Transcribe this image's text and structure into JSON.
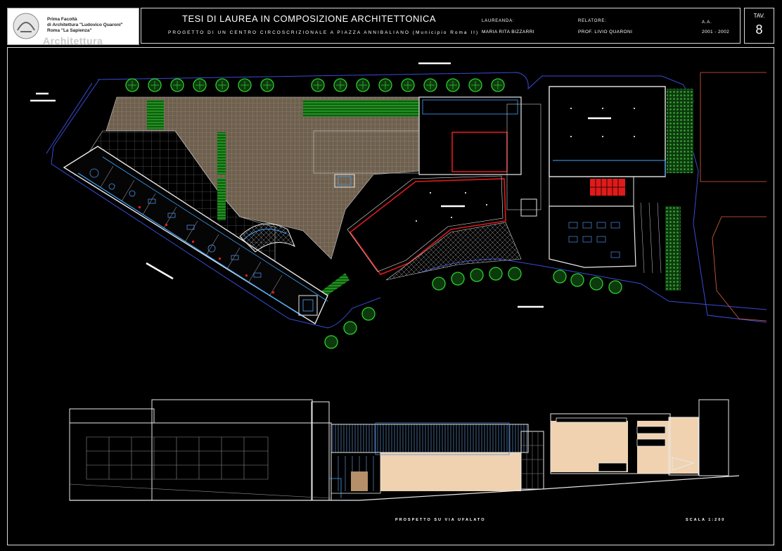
{
  "logo": {
    "lines": [
      "Prima Facoltà",
      "di Architettura \"Ludovico Quaroni\"",
      "Roma \"La Sapienza\""
    ],
    "wordmark": "Architettura"
  },
  "title_block": {
    "title": "TESI DI LAUREA IN COMPOSIZIONE ARCHITETTONICA",
    "subtitle": "PROGETTO DI UN CENTRO CIRCOSCRIZIONALE A PIAZZA ANNIBALIANO (Municipio Roma II)",
    "laureanda_label": "LAUREANDA:",
    "laureanda": "MARIA RITA BIZZARRI",
    "relatore_label": "RELATORE:",
    "relatore": "PROF. LIVIO QUARONI",
    "aa_label": "A.A.",
    "aa": "2001 - 2002"
  },
  "sheet": {
    "tav_label": "TAV.",
    "tav_number": "8"
  },
  "captions": {
    "elevation": "PROSPETTO SU VIA UFALATO",
    "scale": "SCALA 1:200"
  },
  "colors": {
    "tree": "#2ecc2e",
    "wall": "#e8e8e8",
    "glazing": "#3fa7ff",
    "accent_red": "#e11a1a",
    "pavement": "#7a6a58",
    "site_outline": "#3a4bd6",
    "facade_fill": "#f0d2b0"
  }
}
